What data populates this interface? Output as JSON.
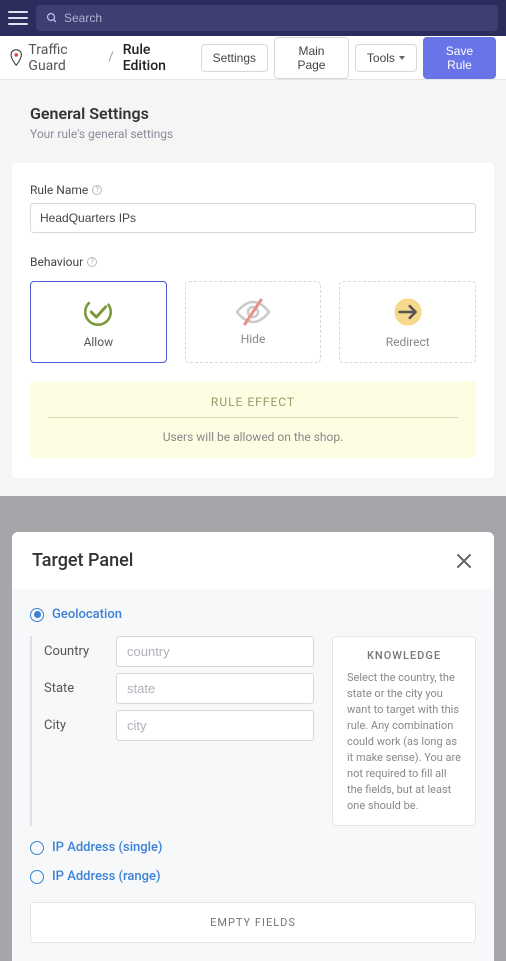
{
  "topbar": {
    "search_placeholder": "Search"
  },
  "header": {
    "brand": "Traffic Guard",
    "page": "Rule Edition",
    "buttons": {
      "settings": "Settings",
      "main_page": "Main Page",
      "tools": "Tools",
      "save": "Save Rule"
    }
  },
  "general": {
    "title": "General Settings",
    "subtitle": "Your rule's general settings"
  },
  "rule_name": {
    "label": "Rule Name",
    "value": "HeadQuarters IPs"
  },
  "behaviour": {
    "label": "Behaviour",
    "options": {
      "allow": "Allow",
      "hide": "Hide",
      "redirect": "Redirect"
    }
  },
  "effect": {
    "title": "RULE EFFECT",
    "body": "Users will be allowed on the shop."
  },
  "panel": {
    "title": "Target Panel",
    "geolocation": "Geolocation",
    "country_label": "Country",
    "country_ph": "country",
    "state_label": "State",
    "state_ph": "state",
    "city_label": "City",
    "city_ph": "city",
    "ip_single": "IP Address (single)",
    "ip_range": "IP Address (range)",
    "knowledge_title": "KNOWLEDGE",
    "knowledge_body": "Select the country, the state or the city you want to target with this rule. Any combination could work (as long as it make sense). You are not required to fill all the fields, but at least one should be.",
    "empty_fields": "EMPTY FIELDS"
  }
}
